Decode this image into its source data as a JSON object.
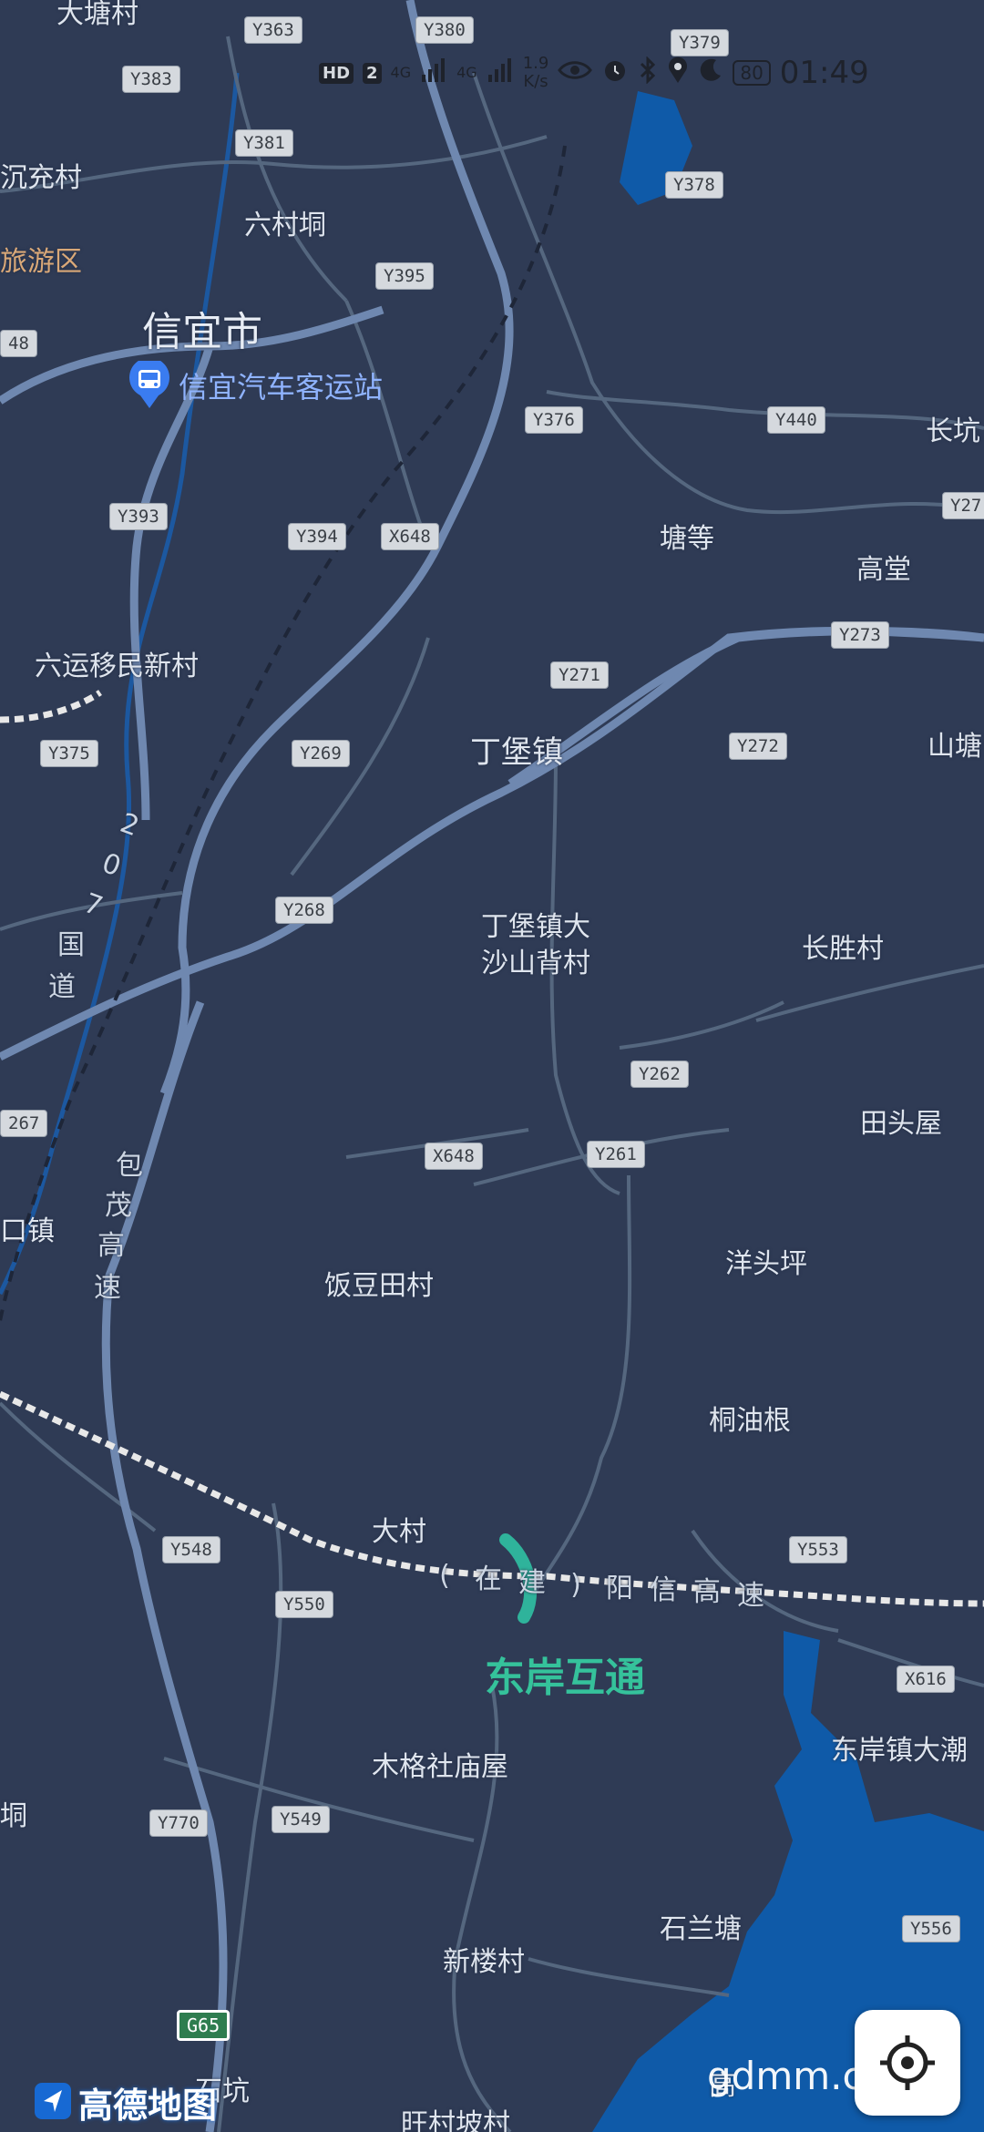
{
  "status_bar": {
    "hd_badge": "HD",
    "hd_number": "2",
    "network_1": "4G",
    "network_2": "4G",
    "speed_value": "1.9",
    "speed_unit": "K/s",
    "battery": "80",
    "time": "01:49"
  },
  "icons": {
    "eye": "eye-icon",
    "alarm": "alarm-icon",
    "bluetooth": "bluetooth-icon",
    "location": "location-icon",
    "moon": "moon-icon",
    "bus": "bus-station-icon",
    "locate": "locate-me-icon",
    "logo": "amap-logo-icon"
  },
  "colors": {
    "map_bg": "#2f3b55",
    "road_major": "#6f88b0",
    "road_minor": "#55677f",
    "water": "#0f5aa8",
    "interchange": "#35c29b",
    "poi_text": "#8fb3ff"
  },
  "places": {
    "dutang": "大塘村",
    "chenchong": "沉充村",
    "lvyouqu": "旅游区",
    "xinyi": "信宜市",
    "liucundong": "六村垌",
    "tangdeng": "塘等",
    "gaotang": "高堂",
    "changkeng": "长坑",
    "liuyun": "六运移民新村",
    "dingbao": "丁堡镇",
    "shantang": "山塘",
    "shashanbei_1": "丁堡镇大",
    "shashanbei_2": "沙山背村",
    "changsheng": "长胜村",
    "tiantouwu": "田头屋",
    "kouzhen": "口镇",
    "yangtouping": "洋头坪",
    "fandoutian": "饭豆田村",
    "tongyougen": "桐油根",
    "dacun": "大村",
    "dongan_town": "东岸镇大潮",
    "mugeshe": "木格社庙屋",
    "dong_left": "垌",
    "shilantang": "石兰塘",
    "xinloucun": "新楼村",
    "shikeng": "石坑",
    "wangcun": "旺村坡村",
    "gao_partial": "高"
  },
  "poi": {
    "bus_station": "信宜汽车客运站",
    "interchange": "东岸互通"
  },
  "highways": {
    "guodao_207": [
      "2",
      "0",
      "7",
      "国",
      "道"
    ],
    "baomao": [
      "包",
      "茂",
      "高",
      "速"
    ],
    "yangxin": [
      "(",
      "在",
      "建",
      ")",
      "阳",
      "信",
      "高",
      "速"
    ]
  },
  "road_shields": {
    "y363": "Y363",
    "y380": "Y380",
    "y379": "Y379",
    "y383": "Y383",
    "y381": "Y381",
    "y378": "Y378",
    "y395": "Y395",
    "y376": "Y376",
    "y440": "Y440",
    "y48": "48",
    "y27": "Y27",
    "y393": "Y393",
    "y394": "Y394",
    "x648a": "X648",
    "y273": "Y273",
    "y271": "Y271",
    "y375": "Y375",
    "y269": "Y269",
    "y272": "Y272",
    "y268": "Y268",
    "y262": "Y262",
    "y267": "267",
    "x648b": "X648",
    "y261": "Y261",
    "y548": "Y548",
    "y550": "Y550",
    "y553": "Y553",
    "x616": "X616",
    "y770": "Y770",
    "y549": "Y549",
    "y556": "Y556",
    "g65": "G65"
  },
  "logo_text": "高德地图",
  "watermark": "gdmm.com"
}
